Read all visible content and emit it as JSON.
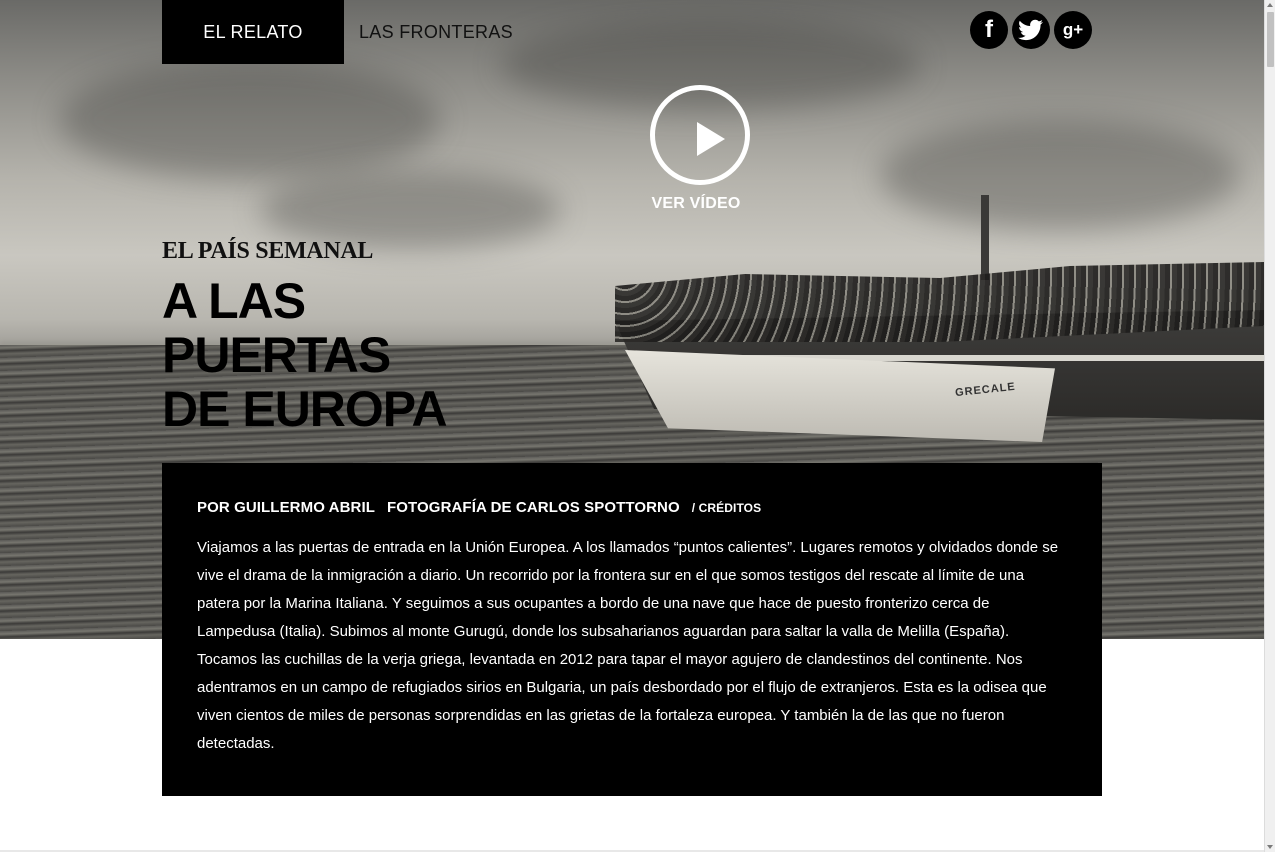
{
  "nav": {
    "tabs": [
      {
        "label": "EL RELATO",
        "active": true
      },
      {
        "label": "LAS FRONTERAS",
        "active": false
      }
    ]
  },
  "social": {
    "facebook": "f",
    "twitter": "t",
    "googleplus": "g+"
  },
  "video": {
    "label": "VER VÍDEO"
  },
  "masthead": "EL PAÍS SEMANAL",
  "headline": {
    "line1": "A LAS",
    "line2": "PUERTAS",
    "line3": "DE EUROPA"
  },
  "photo": {
    "boat_name": "GRECALE"
  },
  "article": {
    "author": "POR GUILLERMO ABRIL",
    "photographer": "FOTOGRAFÍA DE CARLOS SPOTTORNO",
    "credits_link": "/ CRÉDITOS",
    "intro": "Viajamos a las puertas de entrada en la Unión Europea. A los llamados “puntos calientes”. Lugares remotos y olvidados donde se vive el drama de la inmigración a diario. Un recorrido por la frontera sur en el que somos testigos del rescate al límite de una patera por la Marina Italiana. Y seguimos a sus ocupantes a bordo de una nave que hace de puesto fronterizo cerca de Lampedusa (Italia). Subimos al monte Gurugú, donde los subsaharianos aguardan para saltar la valla de Melilla (España). Tocamos las cuchillas de la verja griega, levantada en 2012 para tapar el mayor agujero de clandestinos del continente. Nos adentramos en un campo de refugiados sirios en Bulgaria, un país desbordado por el flujo de extranjeros. Esta es la odisea que viven cientos de miles de personas sorprendidas en las grietas de la fortaleza europea. Y también la de las que no fueron detectadas."
  }
}
